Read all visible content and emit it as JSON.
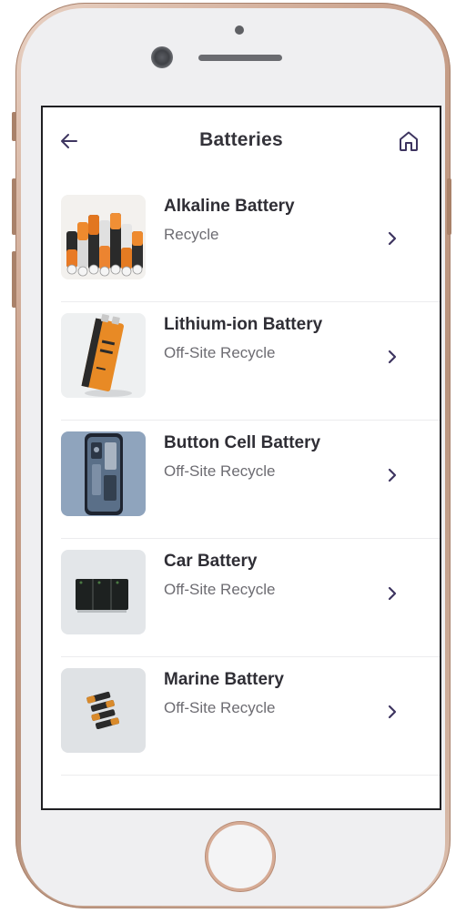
{
  "header": {
    "title": "Batteries",
    "back_icon": "arrow-left-icon",
    "home_icon": "home-icon"
  },
  "items": [
    {
      "name": "Alkaline Battery",
      "status": "Recycle",
      "image": "alkaline-batteries-image"
    },
    {
      "name": "Lithium-ion Battery",
      "status": "Off-Site Recycle",
      "image": "lithium-ion-battery-image"
    },
    {
      "name": "Button Cell Battery",
      "status": "Off-Site Recycle",
      "image": "button-cell-battery-image"
    },
    {
      "name": "Car Battery",
      "status": "Off-Site Recycle",
      "image": "car-battery-image"
    },
    {
      "name": "Marine Battery",
      "status": "Off-Site Recycle",
      "image": "marine-battery-image"
    }
  ],
  "colors": {
    "accent": "#3e3560",
    "title_text": "#34333a",
    "subtitle_text": "#6d6c72",
    "divider": "#ececee"
  }
}
